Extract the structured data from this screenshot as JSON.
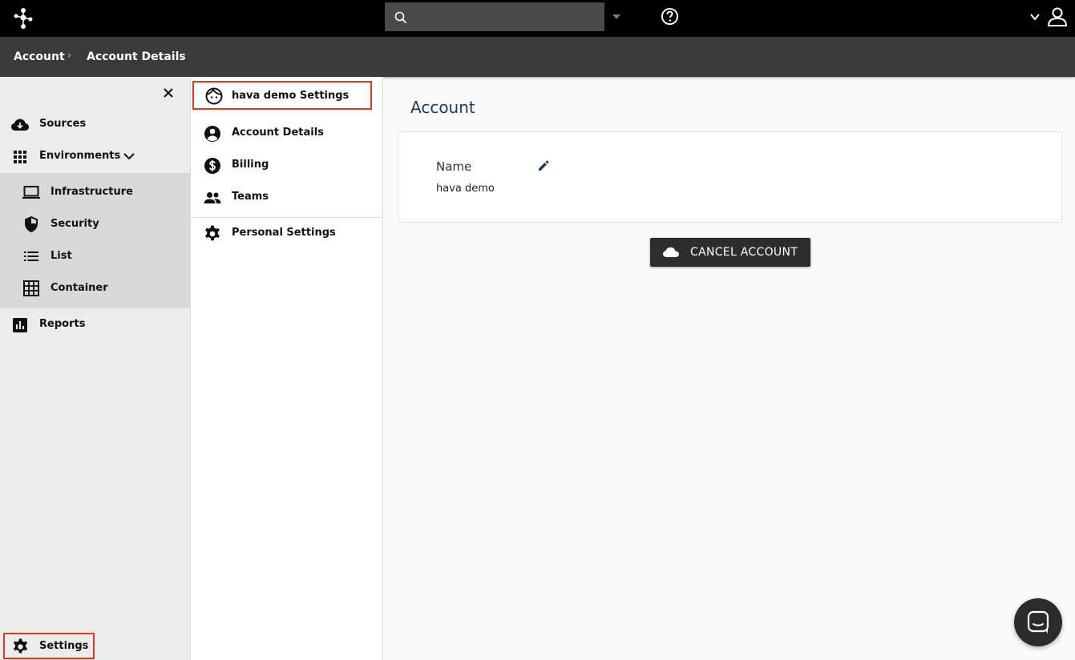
{
  "topbar": {
    "logo_icon": "hava-logo-icon",
    "search": {
      "placeholder": "",
      "value": ""
    },
    "help_icon": "help-circle-icon",
    "user_icon": "user-icon"
  },
  "breadcrumb": {
    "items": [
      "Account",
      "Account Details"
    ],
    "separator": "›"
  },
  "sidebar": {
    "items": [
      {
        "label": "Sources",
        "icon": "cloud-download-icon"
      },
      {
        "label": "Environments",
        "icon": "grid-icon"
      },
      {
        "label": "Reports",
        "icon": "bar-chart-icon"
      }
    ],
    "environments_sub": [
      {
        "label": "Infrastructure",
        "icon": "laptop-icon"
      },
      {
        "label": "Security",
        "icon": "shield-icon"
      },
      {
        "label": "List",
        "icon": "list-icon"
      },
      {
        "label": "Container",
        "icon": "container-grid-icon"
      }
    ],
    "settings_label": "Settings"
  },
  "settings_menu": {
    "header": "hava demo Settings",
    "items": [
      {
        "label": "Account Details",
        "icon": "account-circle-icon"
      },
      {
        "label": "Billing",
        "icon": "dollar-circle-icon"
      },
      {
        "label": "Teams",
        "icon": "people-icon"
      }
    ],
    "personal": {
      "label": "Personal Settings",
      "icon": "gear-icon"
    }
  },
  "main": {
    "title": "Account",
    "name_label": "Name",
    "name_value": "hava demo",
    "cancel_button": "CANCEL ACCOUNT"
  },
  "colors": {
    "highlight": "#e03a1e",
    "topbar": "#000000",
    "crumbbar": "#3a3a3a",
    "title": "#1f3a55"
  }
}
